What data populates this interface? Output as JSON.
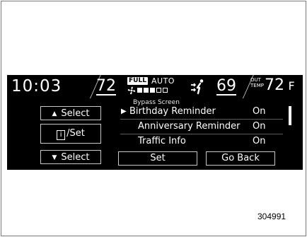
{
  "status_bar": {
    "clock": "10:03",
    "driver_temp": "72",
    "fan_badge": "FULL",
    "mode": "AUTO",
    "fan_level": 0.6,
    "passenger_temp": "69",
    "outside_label_line1": "OUT",
    "outside_label_line2": "TEMP",
    "outside_temp": "72",
    "outside_unit": "F",
    "degree": "°"
  },
  "screen": {
    "title": "Bypass Screen",
    "rows": [
      {
        "label": "Birthday Reminder",
        "value": "On",
        "selected": true
      },
      {
        "label": "Anniversary Reminder",
        "value": "On",
        "selected": false
      },
      {
        "label": "Traffic Info",
        "value": "On",
        "selected": false
      }
    ],
    "selection_arrow": "▶"
  },
  "controls": {
    "select_up": "Select",
    "select_up_glyph": "▲",
    "info_set": "/Set",
    "info_glyph": "i",
    "select_down": "Select",
    "select_down_glyph": "▼",
    "set": "Set",
    "go_back": "Go Back"
  },
  "figure_code": "304991",
  "colors": {
    "screen_bg": "#000000",
    "text": "#ffffff",
    "border": "#c8c8c8"
  }
}
